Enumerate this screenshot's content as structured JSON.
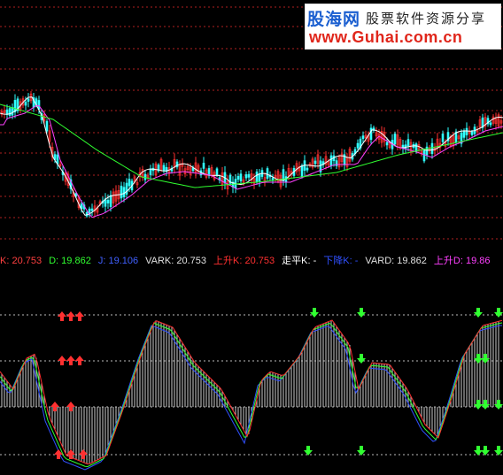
{
  "watermark": {
    "logo": "股海网",
    "slogan": "股票软件资源分享",
    "url": "www.Guhai.com.cn"
  },
  "legend": [
    {
      "label": "K: ",
      "value": "20.753",
      "color": "#ff4040"
    },
    {
      "label": "D: ",
      "value": "19.862",
      "color": "#30ff30"
    },
    {
      "label": "J: ",
      "value": "19.106",
      "color": "#4060ff"
    },
    {
      "label": "VARK: ",
      "value": "20.753",
      "color": "#e0e0e0"
    },
    {
      "label": "上升K: ",
      "value": "20.753",
      "color": "#ff3030"
    },
    {
      "label": "走平K: ",
      "value": "-",
      "color": "#ffffff"
    },
    {
      "label": "下降K: ",
      "value": "-",
      "color": "#3050ff"
    },
    {
      "label": "VARD: ",
      "value": "19.862",
      "color": "#e0e0e0"
    },
    {
      "label": "上升D: ",
      "value": "19.86",
      "color": "#ff40ff"
    }
  ],
  "colors": {
    "up_candle": "#ff3030",
    "down_candle": "#30ffff",
    "ma_short": "#ffffff",
    "ma_mid": "#ff40ff",
    "ma_long": "#30ff30",
    "k_line": "#ff3030",
    "d_line": "#30ff30",
    "j_line": "#3050ff",
    "grid": "#b02020"
  },
  "icons": {
    "buy_signal": "red-up-arrow-icon",
    "sell_signal": "green-down-arrow-icon"
  }
}
